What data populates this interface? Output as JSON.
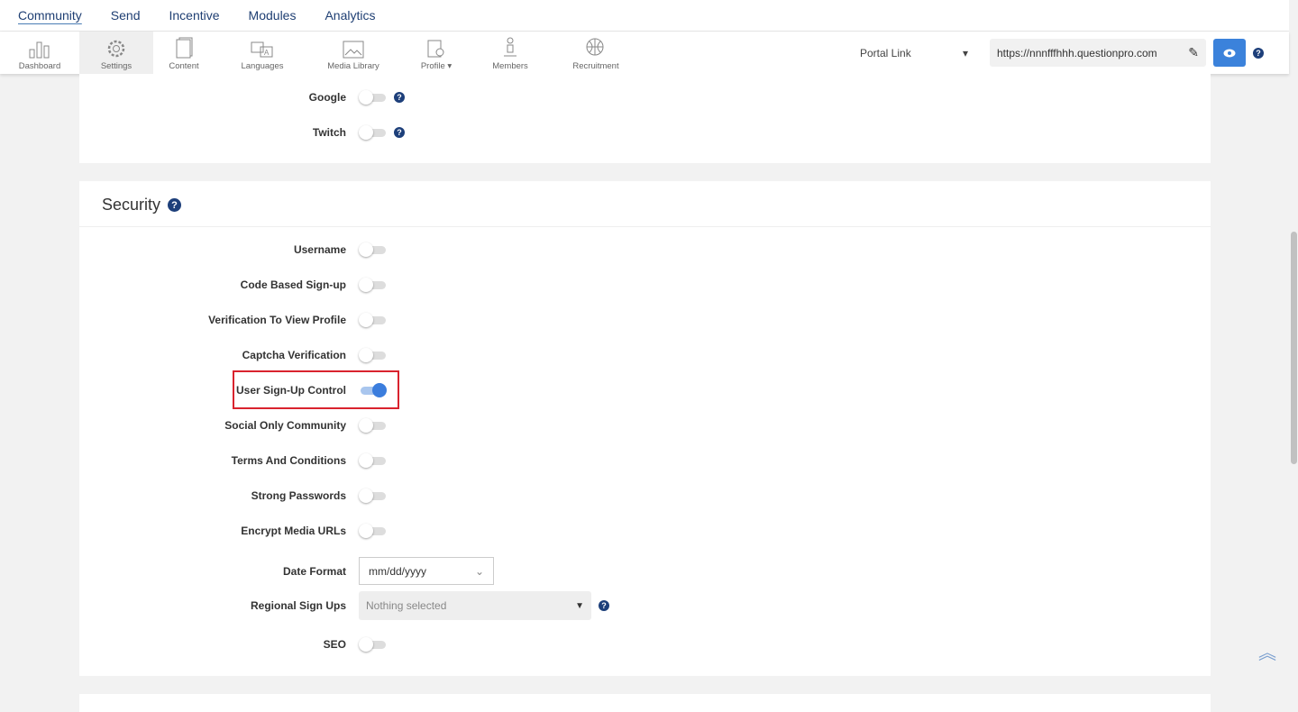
{
  "topnav": [
    "Community",
    "Send",
    "Incentive",
    "Modules",
    "Analytics"
  ],
  "subnav": {
    "items": [
      "Dashboard",
      "Settings",
      "Content",
      "Languages",
      "Media Library",
      "Profile",
      "Members",
      "Recruitment"
    ],
    "portal_label": "Portal Link",
    "url": "https://nnnfffhhh.questionpro.com"
  },
  "social": [
    {
      "label": "Google",
      "on": false
    },
    {
      "label": "Twitch",
      "on": false
    }
  ],
  "security": {
    "title": "Security",
    "toggles": [
      {
        "label": "Username",
        "on": false
      },
      {
        "label": "Code Based Sign-up",
        "on": false
      },
      {
        "label": "Verification To View Profile",
        "on": false
      },
      {
        "label": "Captcha Verification",
        "on": false
      },
      {
        "label": "User Sign-Up Control",
        "on": true
      },
      {
        "label": "Social Only Community",
        "on": false
      },
      {
        "label": "Terms And Conditions",
        "on": false
      },
      {
        "label": "Strong Passwords",
        "on": false
      },
      {
        "label": "Encrypt Media URLs",
        "on": false
      }
    ],
    "date_format": {
      "label": "Date Format",
      "value": "mm/dd/yyyy"
    },
    "regional": {
      "label": "Regional Sign Ups",
      "placeholder": "Nothing selected"
    },
    "seo": {
      "label": "SEO",
      "on": false
    }
  },
  "colors": {
    "accent": "#3b82db",
    "highlight": "#d9232e"
  }
}
